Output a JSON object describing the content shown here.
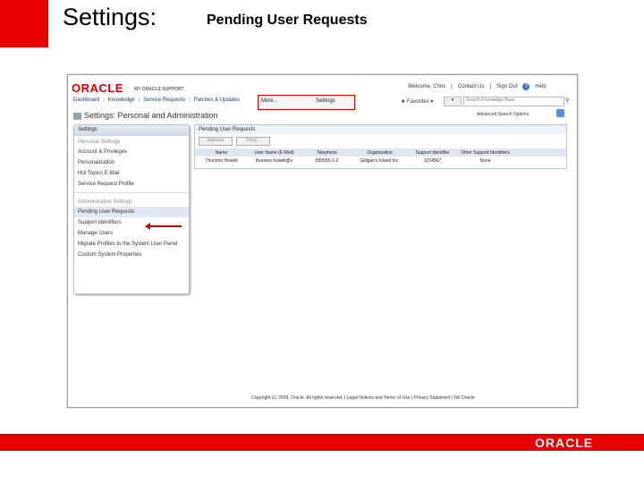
{
  "slide": {
    "title": "Settings:",
    "subtitle": "Pending User Requests",
    "footer_logo": "ORACLE"
  },
  "app": {
    "logo": "ORACLE",
    "product": "MY ORACLE SUPPORT",
    "welcome": "Welcome, Chris",
    "contact": "Contact Us",
    "signout": "Sign Out",
    "help": "Help",
    "nav": [
      "Dashboard",
      "Knowledge",
      "Service Requests",
      "Patches & Updates"
    ],
    "more": "More...",
    "settings": "Settings",
    "favorites": "Favorites",
    "search_placeholder": "Search Knowledge Base",
    "advanced": "Advanced Search Options",
    "page_title": "Settings: Personal and Administration"
  },
  "sidebar": {
    "header": "Settings",
    "personal_section": "Personal Settings",
    "personal_items": [
      "Account & Privileges",
      "Personalization",
      "Hot Topics E-Mail",
      "Service Request Profile"
    ],
    "admin_section": "Administrative Settings",
    "admin_items": [
      "Pending User Requests",
      "Support Identifiers",
      "Manage Users",
      "Migrate Profiles to the System User Panel",
      "Custom System Properties"
    ]
  },
  "main": {
    "title": "Pending User Requests",
    "approve": "Approve",
    "deny": "Deny...",
    "columns": [
      "Name",
      "User Name (E-Mail)",
      "Telephone",
      "Organization",
      "Support Identifier",
      "Other Support Identifiers"
    ],
    "row": [
      "Thurston Howell",
      "thurston.howell@s",
      "555555-2-2",
      "Gilligan's Island Inc.",
      "1234567",
      "None"
    ]
  },
  "footer": {
    "text": "Copyright (c) 2009, Oracle. All rights reserved.  |  Legal Notices and Terms of Use  |  Privacy Statement  |  Tell Oracle"
  }
}
